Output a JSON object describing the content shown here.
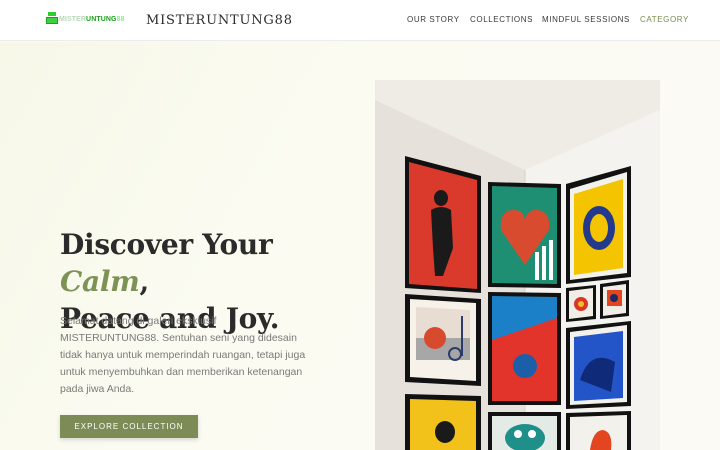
{
  "header": {
    "logo": {
      "part1": "MISTER",
      "part2": "UNTUNG",
      "part3": "88"
    },
    "brand": "MISTERUNTUNG88",
    "nav": [
      {
        "label": "OUR STORY"
      },
      {
        "label": "COLLECTIONS"
      },
      {
        "label": "MINDFUL SESSIONS"
      },
      {
        "label": "CATEGORY"
      }
    ]
  },
  "hero": {
    "headline_part1": "Discover Your ",
    "headline_accent": "Calm",
    "headline_part2": ",",
    "headline_line2": "Peace and Joy.",
    "intro": "Selamat datang di galeri eksklusif MISTERUNTUNG88. Sentuhan seni yang didesain tidak hanya untuk memperindah ruangan, tetapi juga untuk menyembuhkan dan memberikan ketenangan pada jiwa Anda.",
    "cta_label": "EXPLORE COLLECTION"
  },
  "colors": {
    "accent": "#7d9355",
    "button": "#7d8c56",
    "nav_active": "#7a8c4a"
  }
}
